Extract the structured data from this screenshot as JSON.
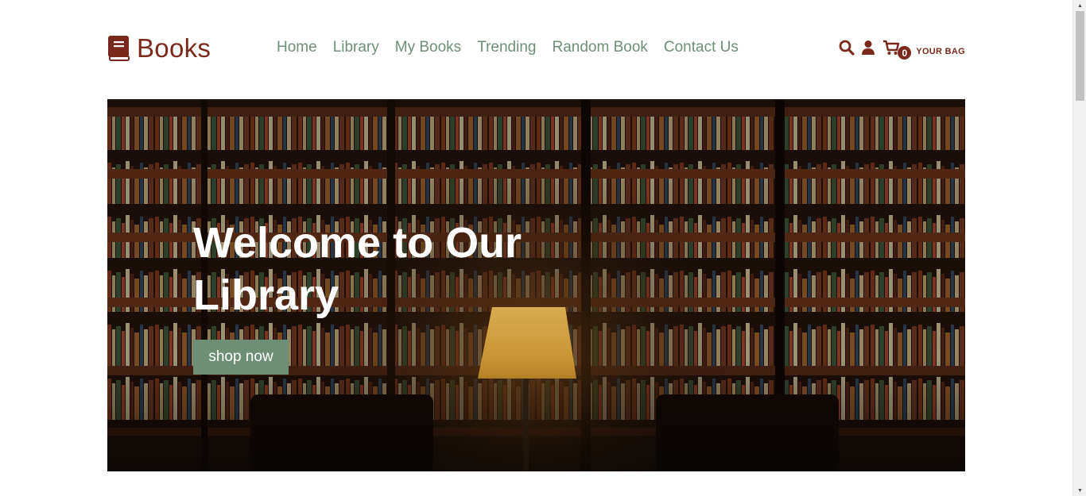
{
  "brand": {
    "name": "Books",
    "icon": "book-icon",
    "color": "#7a2a1c"
  },
  "nav": {
    "items": [
      {
        "label": "Home"
      },
      {
        "label": "Library"
      },
      {
        "label": "My Books"
      },
      {
        "label": "Trending"
      },
      {
        "label": "Random Book"
      },
      {
        "label": "Contact Us"
      }
    ],
    "color": "#6e8e76"
  },
  "header_icons": {
    "search": "search-icon",
    "user": "user-icon",
    "cart": "cart-icon",
    "cart_count": "0",
    "bag_label": "YOUR BAG"
  },
  "hero": {
    "title": "Welcome to Our Library",
    "button_label": "shop now",
    "button_color": "#6e8e76"
  }
}
